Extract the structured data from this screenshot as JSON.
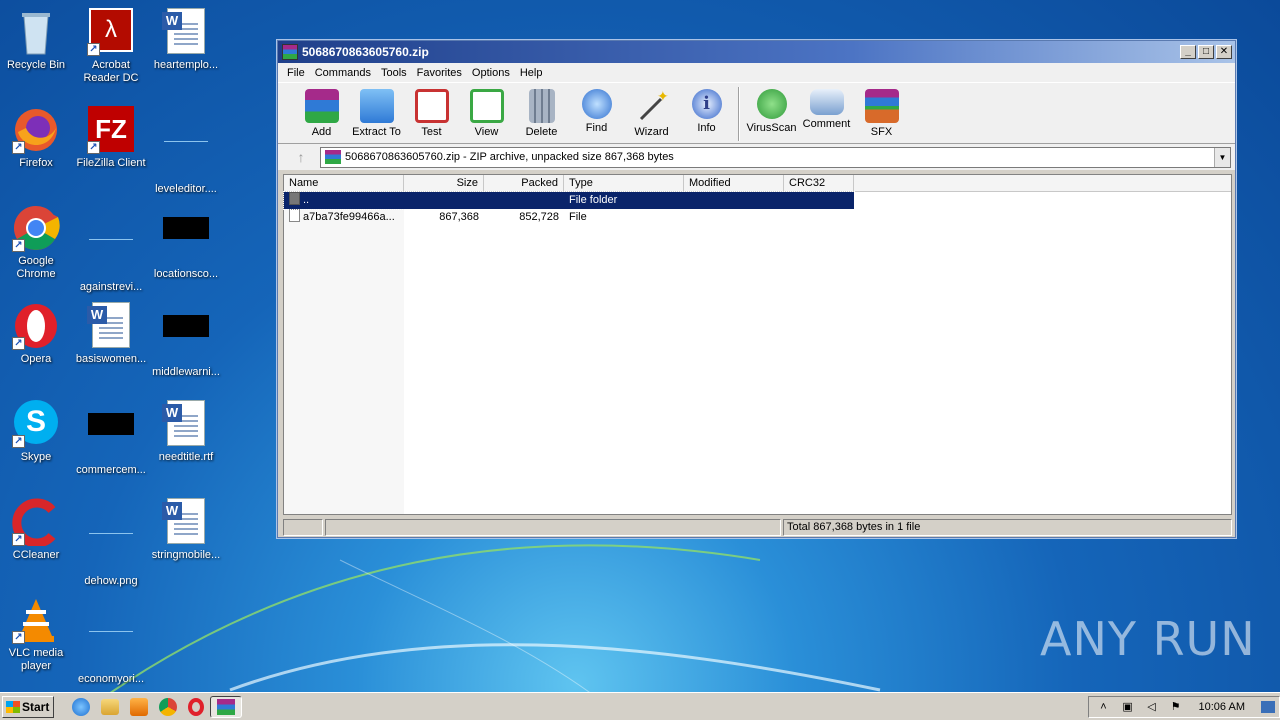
{
  "desktop": {
    "icons": [
      {
        "label": "Recycle Bin"
      },
      {
        "label": "Acrobat\nReader DC"
      },
      {
        "label": "heartemplo..."
      },
      {
        "label": "Firefox"
      },
      {
        "label": "FileZilla Client"
      },
      {
        "label": "leveleditor...."
      },
      {
        "label": "Google\nChrome"
      },
      {
        "label": "againstrevi..."
      },
      {
        "label": "locationsco..."
      },
      {
        "label": "Opera"
      },
      {
        "label": "basiswomen..."
      },
      {
        "label": "middlewarni..."
      },
      {
        "label": "Skype"
      },
      {
        "label": "commercem..."
      },
      {
        "label": "needtitle.rtf"
      },
      {
        "label": "CCleaner"
      },
      {
        "label": "dehow.png"
      },
      {
        "label": "stringmobile..."
      },
      {
        "label": "VLC media\nplayer"
      },
      {
        "label": "economyori..."
      }
    ],
    "watermark": "ANY RUN"
  },
  "window": {
    "title": "5068670863605760.zip",
    "controls": {
      "minimize": "_",
      "maximize": "□",
      "close": "✕"
    },
    "menu": [
      "File",
      "Commands",
      "Tools",
      "Favorites",
      "Options",
      "Help"
    ],
    "toolbar": [
      {
        "label": "Add",
        "icon": "add-archive-icon",
        "color": "#8a3fa0"
      },
      {
        "label": "Extract To",
        "icon": "extract-folder-icon",
        "color": "#3d8fe0"
      },
      {
        "label": "Test",
        "icon": "test-checklist-icon",
        "color": "#c83232"
      },
      {
        "label": "View",
        "icon": "view-book-icon",
        "color": "#3aa844"
      },
      {
        "label": "Delete",
        "icon": "delete-trash-icon",
        "color": "#8a96a8"
      },
      {
        "label": "Find",
        "icon": "find-magnifier-icon",
        "color": "#2f6fcf"
      },
      {
        "label": "Wizard",
        "icon": "wizard-wand-icon",
        "color": "#c9a23a"
      },
      {
        "label": "Info",
        "icon": "info-icon",
        "color": "#2f62c8"
      },
      {
        "label": "VirusScan",
        "icon": "virus-scan-icon",
        "color": "#2f9a3a"
      },
      {
        "label": "Comment",
        "icon": "comment-icon",
        "color": "#7aa0d0"
      },
      {
        "label": "SFX",
        "icon": "sfx-box-icon",
        "color": "#d86a2a"
      }
    ],
    "address": "5068670863605760.zip - ZIP archive, unpacked size 867,368 bytes",
    "columns": [
      "Name",
      "Size",
      "Packed",
      "Type",
      "Modified",
      "CRC32"
    ],
    "rows": [
      {
        "name": "..",
        "size": "",
        "packed": "",
        "type": "File folder",
        "modified": "",
        "crc": ""
      },
      {
        "name": "a7ba73fe99466a...",
        "size": "867,368",
        "packed": "852,728",
        "type": "File",
        "modified": "",
        "crc": ""
      }
    ],
    "status": "Total 867,368 bytes in 1 file"
  },
  "taskbar": {
    "start": "Start",
    "clock": "10:06 AM"
  }
}
